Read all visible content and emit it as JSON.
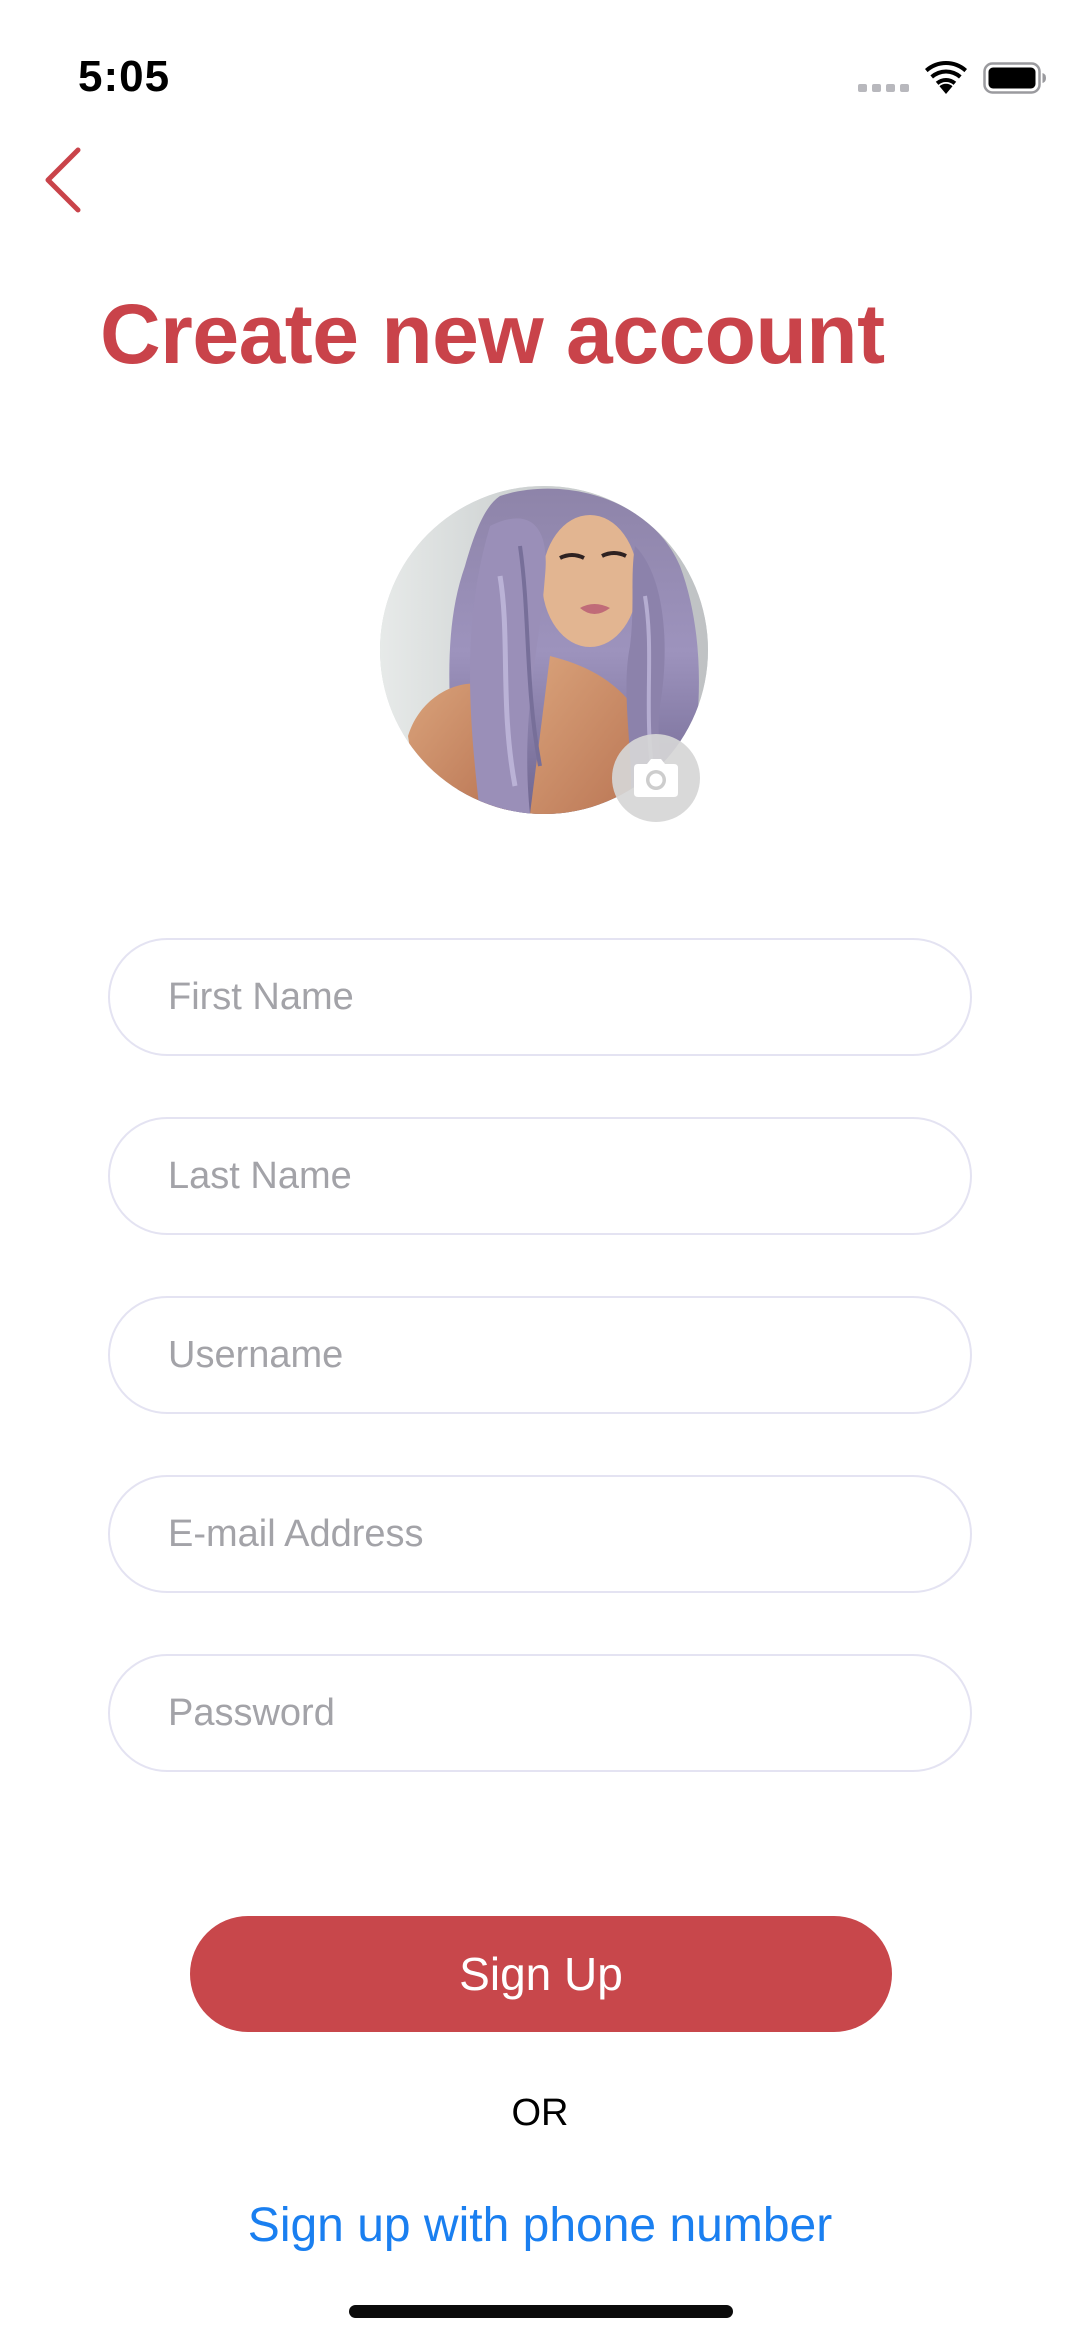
{
  "status_bar": {
    "time": "5:05",
    "icons": [
      "cellular-signal-icon",
      "wifi-icon",
      "battery-icon"
    ]
  },
  "navigation": {
    "back_icon": "chevron-left-icon"
  },
  "header": {
    "title": "Create new account"
  },
  "profile_photo": {
    "camera_icon": "camera-icon"
  },
  "form": {
    "first_name": {
      "placeholder": "First Name",
      "value": ""
    },
    "last_name": {
      "placeholder": "Last Name",
      "value": ""
    },
    "username": {
      "placeholder": "Username",
      "value": ""
    },
    "email": {
      "placeholder": "E-mail Address",
      "value": ""
    },
    "password": {
      "placeholder": "Password",
      "value": ""
    }
  },
  "actions": {
    "signup_label": "Sign Up",
    "or_label": "OR",
    "phone_signup_label": "Sign up with phone number"
  },
  "colors": {
    "accent": "#c8474b",
    "link": "#1a7ff0",
    "field_border": "#e4e3f2",
    "placeholder": "#a3a3a8"
  }
}
